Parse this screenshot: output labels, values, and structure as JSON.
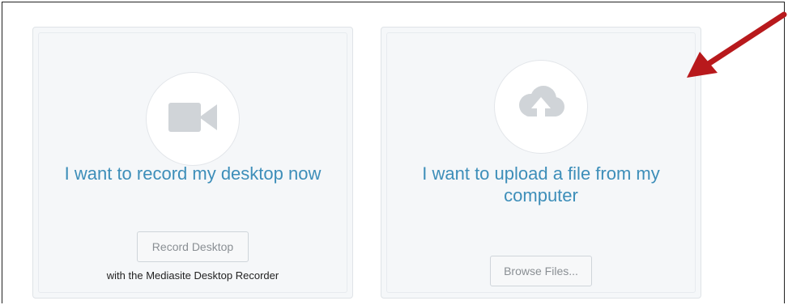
{
  "record_card": {
    "icon": "video-camera-icon",
    "heading": "I want to record my desktop now",
    "button_label": "Record Desktop",
    "caption": "with the Mediasite Desktop Recorder"
  },
  "upload_card": {
    "icon": "cloud-upload-icon",
    "heading_line1": "I want to upload a file from my",
    "heading_line2": "computer",
    "button_label": "Browse Files..."
  },
  "annotation": {
    "arrow_icon": "red-arrow-icon",
    "arrow_color": "#b8191c"
  },
  "colors": {
    "accent_text": "#3d8eb9",
    "card_background": "#f5f7f9",
    "icon_gray": "#d0d4d8"
  }
}
